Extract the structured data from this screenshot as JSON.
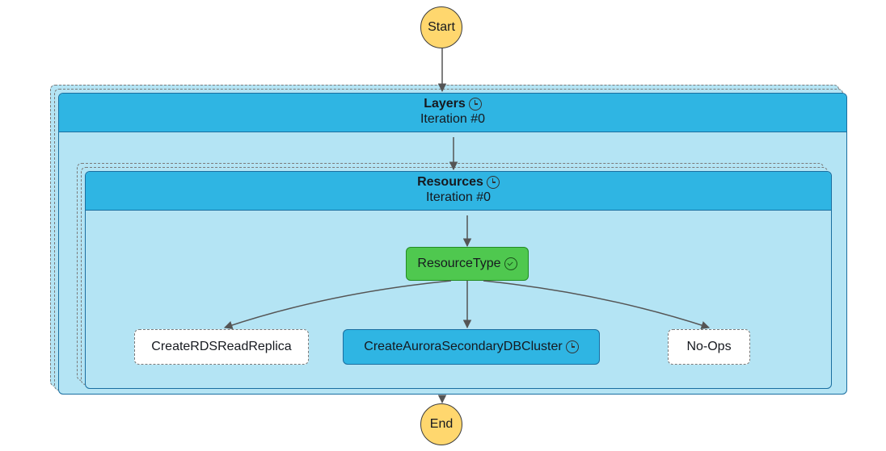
{
  "start": {
    "label": "Start"
  },
  "end": {
    "label": "End"
  },
  "layers": {
    "title": "Layers",
    "iteration": "Iteration #0"
  },
  "resources": {
    "title": "Resources",
    "iteration": "Iteration #0"
  },
  "resourceType": {
    "label": "ResourceType"
  },
  "branches": {
    "rds": "CreateRDSReadReplica",
    "aurora": "CreateAuroraSecondaryDBCluster",
    "noops": "No-Ops"
  },
  "colors": {
    "nodeYellow": "#ffd76e",
    "mapBlue": "#2fb5e3",
    "mapBody": "#b4e4f4",
    "success": "#4fc84f"
  }
}
